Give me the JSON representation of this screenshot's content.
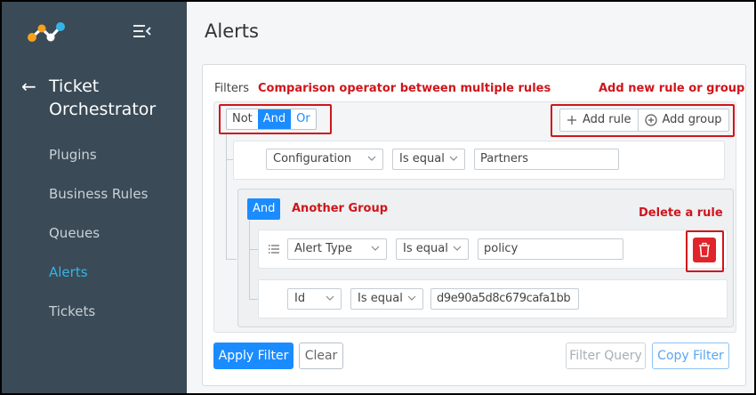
{
  "sidebar": {
    "app_title_line1": "Ticket",
    "app_title_line2": "Orchestrator",
    "items": [
      {
        "label": "Plugins",
        "active": false
      },
      {
        "label": "Business Rules",
        "active": false
      },
      {
        "label": "Queues",
        "active": false
      },
      {
        "label": "Alerts",
        "active": true
      },
      {
        "label": "Tickets",
        "active": false
      }
    ]
  },
  "page": {
    "title": "Alerts"
  },
  "filters": {
    "label": "Filters",
    "conjunctions": [
      "Not",
      "And",
      "Or"
    ],
    "selected_conjunction": "And",
    "add_rule_label": "Add rule",
    "add_group_label": "Add group",
    "rule1": {
      "field": "Configuration",
      "operator": "Is equal",
      "value": "Partners"
    },
    "inner_group": {
      "conjunction": "And",
      "rule1": {
        "field": "Alert Type",
        "operator": "Is equal",
        "value": "policy"
      },
      "rule2": {
        "field": "Id",
        "operator": "Is equal",
        "value": "d9e90a5d8c679cafa1bb"
      }
    }
  },
  "annotations": {
    "comparison": "Comparison operator between multiple rules",
    "add_new": "Add new rule or group",
    "another_group": "Another Group",
    "delete_rule": "Delete a rule"
  },
  "actions": {
    "apply_label": "Apply Filter",
    "clear_label": "Clear",
    "filter_query_label": "Filter Query",
    "copy_filter_label": "Copy Filter"
  },
  "colors": {
    "sidebar_bg": "#3a4a56",
    "accent": "#1a8cff",
    "active_nav": "#35b4e8",
    "annotation": "#d0151b"
  }
}
